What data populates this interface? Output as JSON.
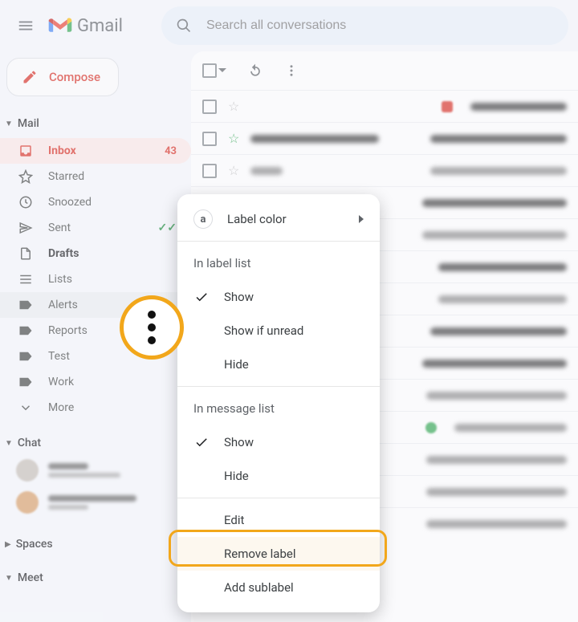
{
  "header": {
    "app_name": "Gmail",
    "search_placeholder": "Search all conversations"
  },
  "compose_label": "Compose",
  "sidebar": {
    "sections": {
      "mail": "Mail",
      "chat": "Chat",
      "spaces": "Spaces",
      "meet": "Meet"
    },
    "items": [
      {
        "icon": "inbox",
        "label": "Inbox",
        "badge": "43",
        "active": true
      },
      {
        "icon": "star",
        "label": "Starred"
      },
      {
        "icon": "clock",
        "label": "Snoozed"
      },
      {
        "icon": "send",
        "label": "Sent",
        "sent_checks": true
      },
      {
        "icon": "file",
        "label": "Drafts",
        "bold": true
      },
      {
        "icon": "lines",
        "label": "Lists"
      },
      {
        "icon": "tag",
        "label": "Alerts",
        "hover": true
      },
      {
        "icon": "tag",
        "label": "Reports"
      },
      {
        "icon": "tag",
        "label": "Test"
      },
      {
        "icon": "tag",
        "label": "Work"
      },
      {
        "icon": "more",
        "label": "More"
      }
    ]
  },
  "context_menu": {
    "label_color": "Label color",
    "section_label_list": "In label list",
    "show": "Show",
    "show_if_unread": "Show if unread",
    "hide": "Hide",
    "section_message_list": "In message list",
    "edit": "Edit",
    "remove": "Remove label",
    "add_sublabel": "Add sublabel",
    "color_chip_letter": "a"
  }
}
